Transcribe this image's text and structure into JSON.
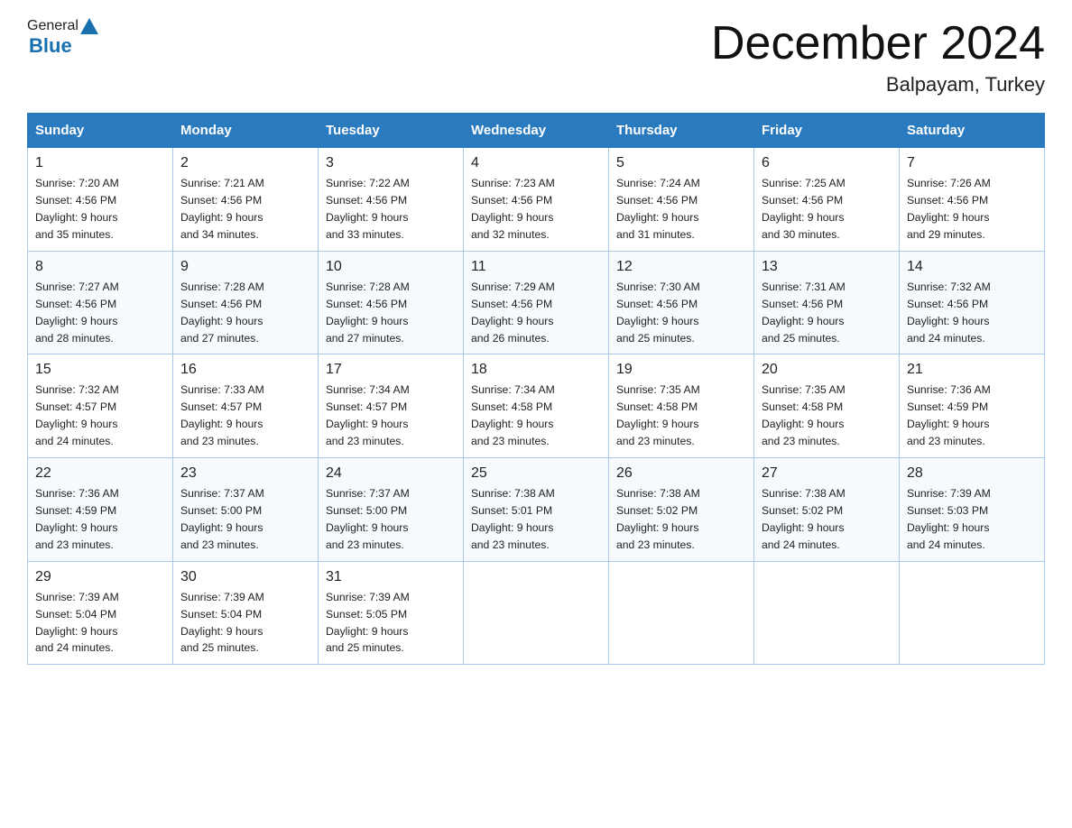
{
  "header": {
    "logo_general": "General",
    "logo_blue": "Blue",
    "month_title": "December 2024",
    "location": "Balpayam, Turkey"
  },
  "days_of_week": [
    "Sunday",
    "Monday",
    "Tuesday",
    "Wednesday",
    "Thursday",
    "Friday",
    "Saturday"
  ],
  "weeks": [
    [
      {
        "day": "1",
        "sunrise": "Sunrise: 7:20 AM",
        "sunset": "Sunset: 4:56 PM",
        "daylight": "Daylight: 9 hours",
        "daylight2": "and 35 minutes."
      },
      {
        "day": "2",
        "sunrise": "Sunrise: 7:21 AM",
        "sunset": "Sunset: 4:56 PM",
        "daylight": "Daylight: 9 hours",
        "daylight2": "and 34 minutes."
      },
      {
        "day": "3",
        "sunrise": "Sunrise: 7:22 AM",
        "sunset": "Sunset: 4:56 PM",
        "daylight": "Daylight: 9 hours",
        "daylight2": "and 33 minutes."
      },
      {
        "day": "4",
        "sunrise": "Sunrise: 7:23 AM",
        "sunset": "Sunset: 4:56 PM",
        "daylight": "Daylight: 9 hours",
        "daylight2": "and 32 minutes."
      },
      {
        "day": "5",
        "sunrise": "Sunrise: 7:24 AM",
        "sunset": "Sunset: 4:56 PM",
        "daylight": "Daylight: 9 hours",
        "daylight2": "and 31 minutes."
      },
      {
        "day": "6",
        "sunrise": "Sunrise: 7:25 AM",
        "sunset": "Sunset: 4:56 PM",
        "daylight": "Daylight: 9 hours",
        "daylight2": "and 30 minutes."
      },
      {
        "day": "7",
        "sunrise": "Sunrise: 7:26 AM",
        "sunset": "Sunset: 4:56 PM",
        "daylight": "Daylight: 9 hours",
        "daylight2": "and 29 minutes."
      }
    ],
    [
      {
        "day": "8",
        "sunrise": "Sunrise: 7:27 AM",
        "sunset": "Sunset: 4:56 PM",
        "daylight": "Daylight: 9 hours",
        "daylight2": "and 28 minutes."
      },
      {
        "day": "9",
        "sunrise": "Sunrise: 7:28 AM",
        "sunset": "Sunset: 4:56 PM",
        "daylight": "Daylight: 9 hours",
        "daylight2": "and 27 minutes."
      },
      {
        "day": "10",
        "sunrise": "Sunrise: 7:28 AM",
        "sunset": "Sunset: 4:56 PM",
        "daylight": "Daylight: 9 hours",
        "daylight2": "and 27 minutes."
      },
      {
        "day": "11",
        "sunrise": "Sunrise: 7:29 AM",
        "sunset": "Sunset: 4:56 PM",
        "daylight": "Daylight: 9 hours",
        "daylight2": "and 26 minutes."
      },
      {
        "day": "12",
        "sunrise": "Sunrise: 7:30 AM",
        "sunset": "Sunset: 4:56 PM",
        "daylight": "Daylight: 9 hours",
        "daylight2": "and 25 minutes."
      },
      {
        "day": "13",
        "sunrise": "Sunrise: 7:31 AM",
        "sunset": "Sunset: 4:56 PM",
        "daylight": "Daylight: 9 hours",
        "daylight2": "and 25 minutes."
      },
      {
        "day": "14",
        "sunrise": "Sunrise: 7:32 AM",
        "sunset": "Sunset: 4:56 PM",
        "daylight": "Daylight: 9 hours",
        "daylight2": "and 24 minutes."
      }
    ],
    [
      {
        "day": "15",
        "sunrise": "Sunrise: 7:32 AM",
        "sunset": "Sunset: 4:57 PM",
        "daylight": "Daylight: 9 hours",
        "daylight2": "and 24 minutes."
      },
      {
        "day": "16",
        "sunrise": "Sunrise: 7:33 AM",
        "sunset": "Sunset: 4:57 PM",
        "daylight": "Daylight: 9 hours",
        "daylight2": "and 23 minutes."
      },
      {
        "day": "17",
        "sunrise": "Sunrise: 7:34 AM",
        "sunset": "Sunset: 4:57 PM",
        "daylight": "Daylight: 9 hours",
        "daylight2": "and 23 minutes."
      },
      {
        "day": "18",
        "sunrise": "Sunrise: 7:34 AM",
        "sunset": "Sunset: 4:58 PM",
        "daylight": "Daylight: 9 hours",
        "daylight2": "and 23 minutes."
      },
      {
        "day": "19",
        "sunrise": "Sunrise: 7:35 AM",
        "sunset": "Sunset: 4:58 PM",
        "daylight": "Daylight: 9 hours",
        "daylight2": "and 23 minutes."
      },
      {
        "day": "20",
        "sunrise": "Sunrise: 7:35 AM",
        "sunset": "Sunset: 4:58 PM",
        "daylight": "Daylight: 9 hours",
        "daylight2": "and 23 minutes."
      },
      {
        "day": "21",
        "sunrise": "Sunrise: 7:36 AM",
        "sunset": "Sunset: 4:59 PM",
        "daylight": "Daylight: 9 hours",
        "daylight2": "and 23 minutes."
      }
    ],
    [
      {
        "day": "22",
        "sunrise": "Sunrise: 7:36 AM",
        "sunset": "Sunset: 4:59 PM",
        "daylight": "Daylight: 9 hours",
        "daylight2": "and 23 minutes."
      },
      {
        "day": "23",
        "sunrise": "Sunrise: 7:37 AM",
        "sunset": "Sunset: 5:00 PM",
        "daylight": "Daylight: 9 hours",
        "daylight2": "and 23 minutes."
      },
      {
        "day": "24",
        "sunrise": "Sunrise: 7:37 AM",
        "sunset": "Sunset: 5:00 PM",
        "daylight": "Daylight: 9 hours",
        "daylight2": "and 23 minutes."
      },
      {
        "day": "25",
        "sunrise": "Sunrise: 7:38 AM",
        "sunset": "Sunset: 5:01 PM",
        "daylight": "Daylight: 9 hours",
        "daylight2": "and 23 minutes."
      },
      {
        "day": "26",
        "sunrise": "Sunrise: 7:38 AM",
        "sunset": "Sunset: 5:02 PM",
        "daylight": "Daylight: 9 hours",
        "daylight2": "and 23 minutes."
      },
      {
        "day": "27",
        "sunrise": "Sunrise: 7:38 AM",
        "sunset": "Sunset: 5:02 PM",
        "daylight": "Daylight: 9 hours",
        "daylight2": "and 24 minutes."
      },
      {
        "day": "28",
        "sunrise": "Sunrise: 7:39 AM",
        "sunset": "Sunset: 5:03 PM",
        "daylight": "Daylight: 9 hours",
        "daylight2": "and 24 minutes."
      }
    ],
    [
      {
        "day": "29",
        "sunrise": "Sunrise: 7:39 AM",
        "sunset": "Sunset: 5:04 PM",
        "daylight": "Daylight: 9 hours",
        "daylight2": "and 24 minutes."
      },
      {
        "day": "30",
        "sunrise": "Sunrise: 7:39 AM",
        "sunset": "Sunset: 5:04 PM",
        "daylight": "Daylight: 9 hours",
        "daylight2": "and 25 minutes."
      },
      {
        "day": "31",
        "sunrise": "Sunrise: 7:39 AM",
        "sunset": "Sunset: 5:05 PM",
        "daylight": "Daylight: 9 hours",
        "daylight2": "and 25 minutes."
      },
      {
        "day": "",
        "sunrise": "",
        "sunset": "",
        "daylight": "",
        "daylight2": ""
      },
      {
        "day": "",
        "sunrise": "",
        "sunset": "",
        "daylight": "",
        "daylight2": ""
      },
      {
        "day": "",
        "sunrise": "",
        "sunset": "",
        "daylight": "",
        "daylight2": ""
      },
      {
        "day": "",
        "sunrise": "",
        "sunset": "",
        "daylight": "",
        "daylight2": ""
      }
    ]
  ]
}
